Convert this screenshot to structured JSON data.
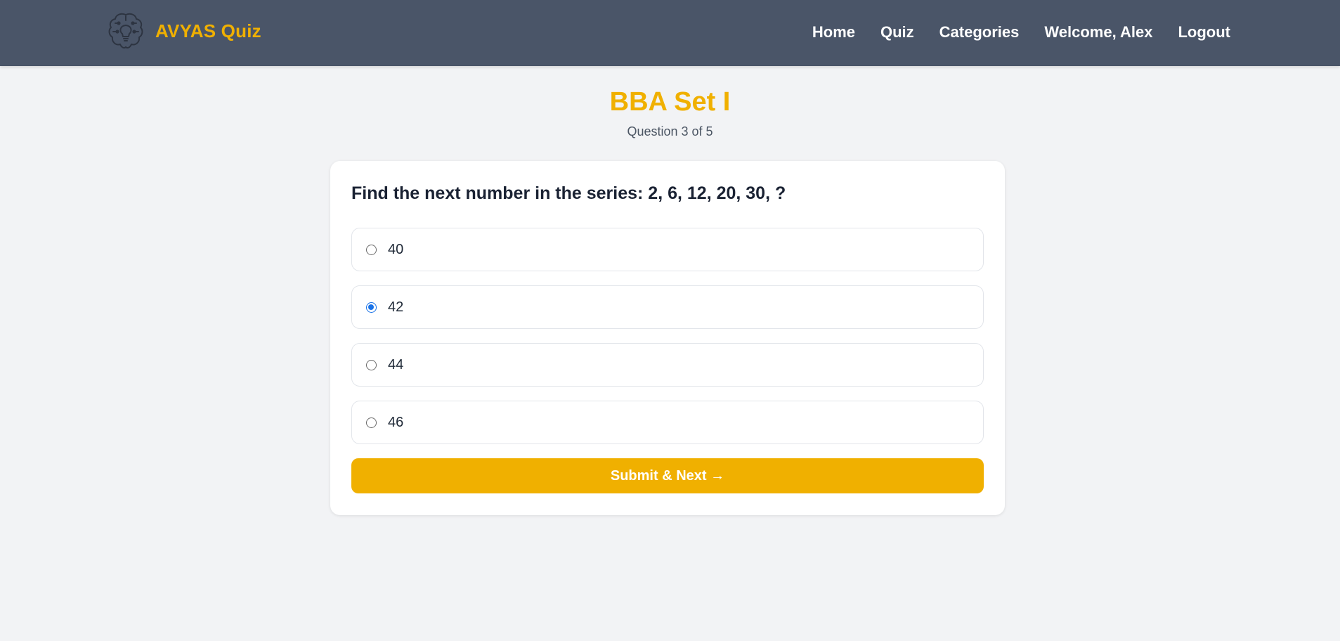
{
  "brand": {
    "name": "AVYAS Quiz",
    "logo_icon": "brain-lightbulb-icon",
    "color": "#f0b000"
  },
  "nav": {
    "items": [
      "Home",
      "Quiz",
      "Categories",
      "Welcome, Alex",
      "Logout"
    ]
  },
  "quiz": {
    "title": "BBA Set I",
    "progress": "Question 3 of 5",
    "question": "Find the next number in the series: 2, 6, 12, 20, 30, ?",
    "options": [
      {
        "label": "40",
        "selected": false
      },
      {
        "label": "42",
        "selected": true
      },
      {
        "label": "44",
        "selected": false
      },
      {
        "label": "46",
        "selected": false
      }
    ],
    "submit_label": "Submit & Next →"
  },
  "colors": {
    "navbar": "#4a5568",
    "accent": "#f0b000",
    "background": "#f2f3f5",
    "radio_selected": "#1a73e8"
  }
}
